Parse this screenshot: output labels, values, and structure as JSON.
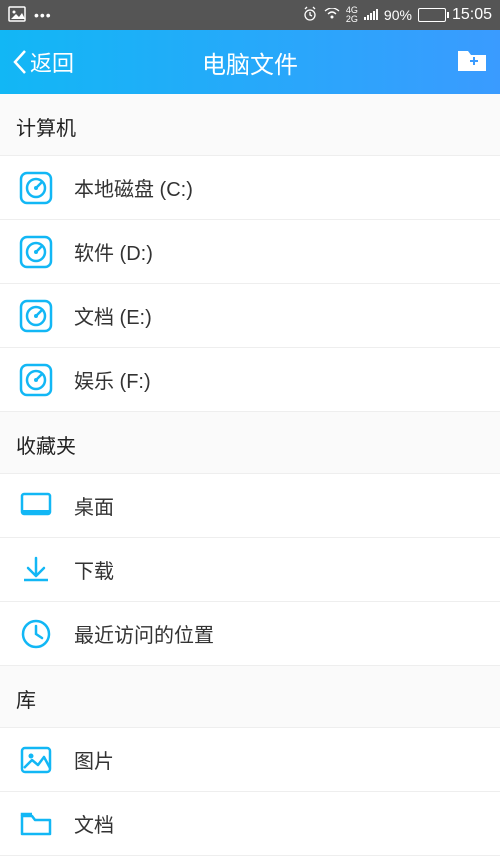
{
  "status": {
    "network_label": "4G 2G",
    "battery_percent": "90%",
    "time": "15:05"
  },
  "header": {
    "back_label": "返回",
    "title": "电脑文件"
  },
  "sections": {
    "computer": {
      "title": "计算机",
      "items": [
        {
          "label": "本地磁盘 (C:)"
        },
        {
          "label": "软件 (D:)"
        },
        {
          "label": "文档 (E:)"
        },
        {
          "label": "娱乐 (F:)"
        }
      ]
    },
    "favorites": {
      "title": "收藏夹",
      "items": [
        {
          "label": "桌面"
        },
        {
          "label": "下载"
        },
        {
          "label": "最近访问的位置"
        }
      ]
    },
    "libraries": {
      "title": "库",
      "items": [
        {
          "label": "图片"
        },
        {
          "label": "文档"
        }
      ]
    }
  }
}
